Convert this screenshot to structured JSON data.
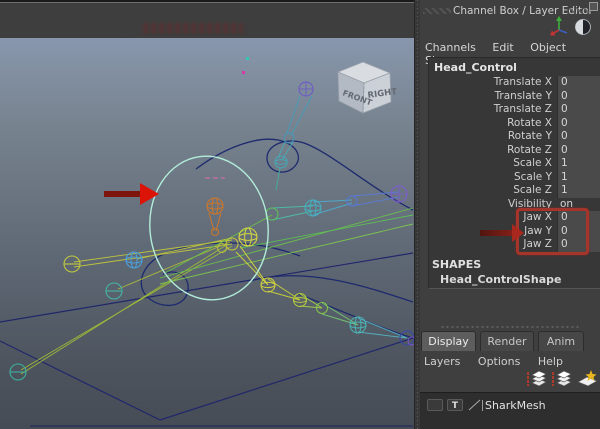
{
  "viewport": {
    "view_cube": {
      "front": "FRONT",
      "right": "RIGHT"
    }
  },
  "channel_box": {
    "title": "Channel Box / Layer Editor",
    "menus": [
      "Channels",
      "Edit",
      "Object",
      "Show"
    ],
    "object_name": "Head_Control",
    "attributes": [
      {
        "name": "Translate X",
        "value": "0",
        "field": true
      },
      {
        "name": "Translate Y",
        "value": "0",
        "field": true
      },
      {
        "name": "Translate Z",
        "value": "0",
        "field": true
      },
      {
        "name": "Rotate X",
        "value": "0",
        "field": true
      },
      {
        "name": "Rotate Y",
        "value": "0",
        "field": true
      },
      {
        "name": "Rotate Z",
        "value": "0",
        "field": true
      },
      {
        "name": "Scale X",
        "value": "1",
        "field": true
      },
      {
        "name": "Scale Y",
        "value": "1",
        "field": true
      },
      {
        "name": "Scale Z",
        "value": "1",
        "field": true
      },
      {
        "name": "Visibility",
        "value": "on",
        "field": false
      },
      {
        "name": "Jaw X",
        "value": "0",
        "field": true,
        "highlight": true
      },
      {
        "name": "Jaw Y",
        "value": "0",
        "field": true,
        "highlight": true
      },
      {
        "name": "Jaw Z",
        "value": "0",
        "field": true,
        "highlight": true
      }
    ],
    "shapes_header": "SHAPES",
    "shape_name": "Head_ControlShape"
  },
  "layer_editor": {
    "tabs": [
      {
        "label": "Display",
        "active": true
      },
      {
        "label": "Render",
        "active": false
      },
      {
        "label": "Anim",
        "active": false
      }
    ],
    "menus": [
      "Layers",
      "Options",
      "Help"
    ],
    "layers": [
      {
        "type_flag": "T",
        "name": "SharkMesh"
      }
    ]
  },
  "annotations": {
    "arrow_color": "#d91f10",
    "box_color": "#a5342a"
  },
  "colors": {
    "panel_bg": "#3f3f3f",
    "channel_field_bg": "#4a4a4a",
    "viewport_top": "#8897ad",
    "viewport_bottom": "#464c55",
    "selected_curve": "#b2ecd9"
  }
}
